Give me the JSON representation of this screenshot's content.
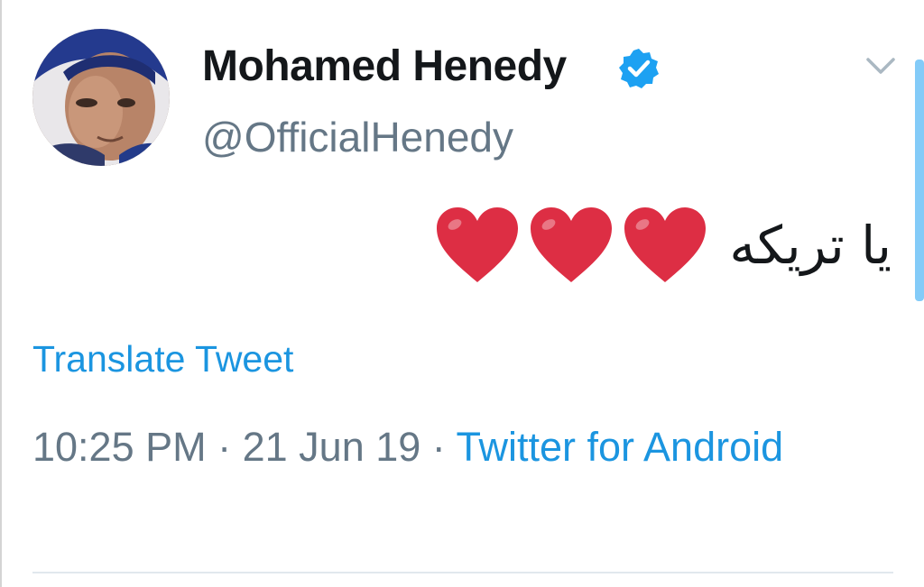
{
  "tweet": {
    "author": {
      "display_name": "Mohamed Henedy",
      "handle": "@OfficialHenedy",
      "verified": true,
      "avatar_icon": "profile-photo"
    },
    "text": "يا تريكه",
    "emoji": [
      "❤️",
      "❤️",
      "❤️"
    ],
    "translate_label": "Translate Tweet",
    "time": "10:25 PM",
    "separator": " · ",
    "date": "21 Jun 19",
    "source": "Twitter for Android",
    "menu_icon": "chevron-down-icon"
  },
  "colors": {
    "link": "#1b95e0",
    "secondary_text": "#657786",
    "primary_text": "#14171a",
    "verified_badge": "#1da1f2",
    "heart": "#dd2e44"
  }
}
